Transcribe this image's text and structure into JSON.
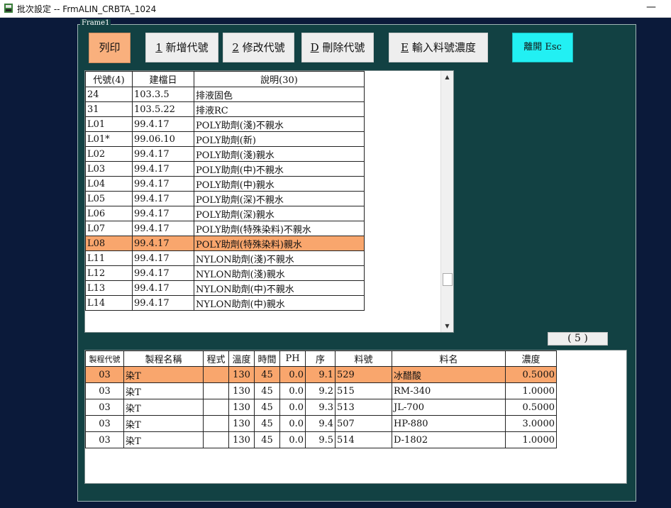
{
  "window": {
    "title": "批次設定 -- FrmALIN_CRBTA_1024",
    "minimize_label": "—"
  },
  "frame": {
    "label": "Frame1"
  },
  "toolbar": {
    "print_label": "列印",
    "add_key": "1",
    "add_label": " 新增代號",
    "edit_key": "2",
    "edit_label": " 修改代號",
    "delete_key": "D",
    "delete_label": " 刪除代號",
    "conc_key": "E",
    "conc_label": " 輸入料號濃度",
    "exit_label": "離開 Esc"
  },
  "codes_table": {
    "headers": [
      "代號(4)",
      "建檔日",
      "說明(30)"
    ],
    "rows": [
      {
        "code": "24",
        "date": "103.3.5",
        "desc": "排液固色"
      },
      {
        "code": "31",
        "date": "103.5.22",
        "desc": "排液RC"
      },
      {
        "code": "L01",
        "date": "99.4.17",
        "desc": "POLY助劑(淺)不親水"
      },
      {
        "code": "L01*",
        "date": "99.06.10",
        "desc": "POLY助劑(新)"
      },
      {
        "code": "L02",
        "date": "99.4.17",
        "desc": "POLY助劑(淺)親水"
      },
      {
        "code": "L03",
        "date": "99.4.17",
        "desc": "POLY助劑(中)不親水"
      },
      {
        "code": "L04",
        "date": "99.4.17",
        "desc": "POLY助劑(中)親水"
      },
      {
        "code": "L05",
        "date": "99.4.17",
        "desc": "POLY助劑(深)不親水"
      },
      {
        "code": "L06",
        "date": "99.4.17",
        "desc": "POLY助劑(深)親水"
      },
      {
        "code": "L07",
        "date": "99.4.17",
        "desc": "POLY助劑(特殊染料)不親水"
      },
      {
        "code": "L08",
        "date": "99.4.17",
        "desc": "POLY助劑(特殊染料)親水"
      },
      {
        "code": "L11",
        "date": "99.4.17",
        "desc": "NYLON助劑(淺)不親水"
      },
      {
        "code": "L12",
        "date": "99.4.17",
        "desc": "NYLON助劑(淺)親水"
      },
      {
        "code": "L13",
        "date": "99.4.17",
        "desc": "NYLON助劑(中)不親水"
      },
      {
        "code": "L14",
        "date": "99.4.17",
        "desc": "NYLON助劑(中)親水"
      }
    ],
    "selected_index": 10
  },
  "record_count": "( 5 )",
  "steps_table": {
    "headers": [
      "製程代號",
      "製程名稱",
      "程式",
      "溫度",
      "時間",
      "PH",
      "序",
      "料號",
      "料名",
      "濃度"
    ],
    "rows": [
      {
        "proc_code": "03",
        "proc_name": "染T",
        "program": "",
        "temp": "130",
        "time": "45",
        "ph": "0.0",
        "seq": "9.1",
        "item_no": "529",
        "item_name": "冰醋酸",
        "conc": "0.5000"
      },
      {
        "proc_code": "03",
        "proc_name": "染T",
        "program": "",
        "temp": "130",
        "time": "45",
        "ph": "0.0",
        "seq": "9.2",
        "item_no": "515",
        "item_name": "RM-340",
        "conc": "1.0000"
      },
      {
        "proc_code": "03",
        "proc_name": "染T",
        "program": "",
        "temp": "130",
        "time": "45",
        "ph": "0.0",
        "seq": "9.3",
        "item_no": "513",
        "item_name": "JL-700",
        "conc": "0.5000"
      },
      {
        "proc_code": "03",
        "proc_name": "染T",
        "program": "",
        "temp": "130",
        "time": "45",
        "ph": "0.0",
        "seq": "9.4",
        "item_no": "507",
        "item_name": "HP-880",
        "conc": "3.0000"
      },
      {
        "proc_code": "03",
        "proc_name": "染T",
        "program": "",
        "temp": "130",
        "time": "45",
        "ph": "0.0",
        "seq": "9.5",
        "item_no": "514",
        "item_name": "D-1802",
        "conc": "1.0000"
      }
    ],
    "selected_index": 0
  },
  "colors": {
    "desktop_bg": "#0b1a3a",
    "frame_bg": "#124143",
    "selection": "#f9a66d",
    "print_button": "#f9b07d",
    "exit_button": "#22f0f3"
  }
}
